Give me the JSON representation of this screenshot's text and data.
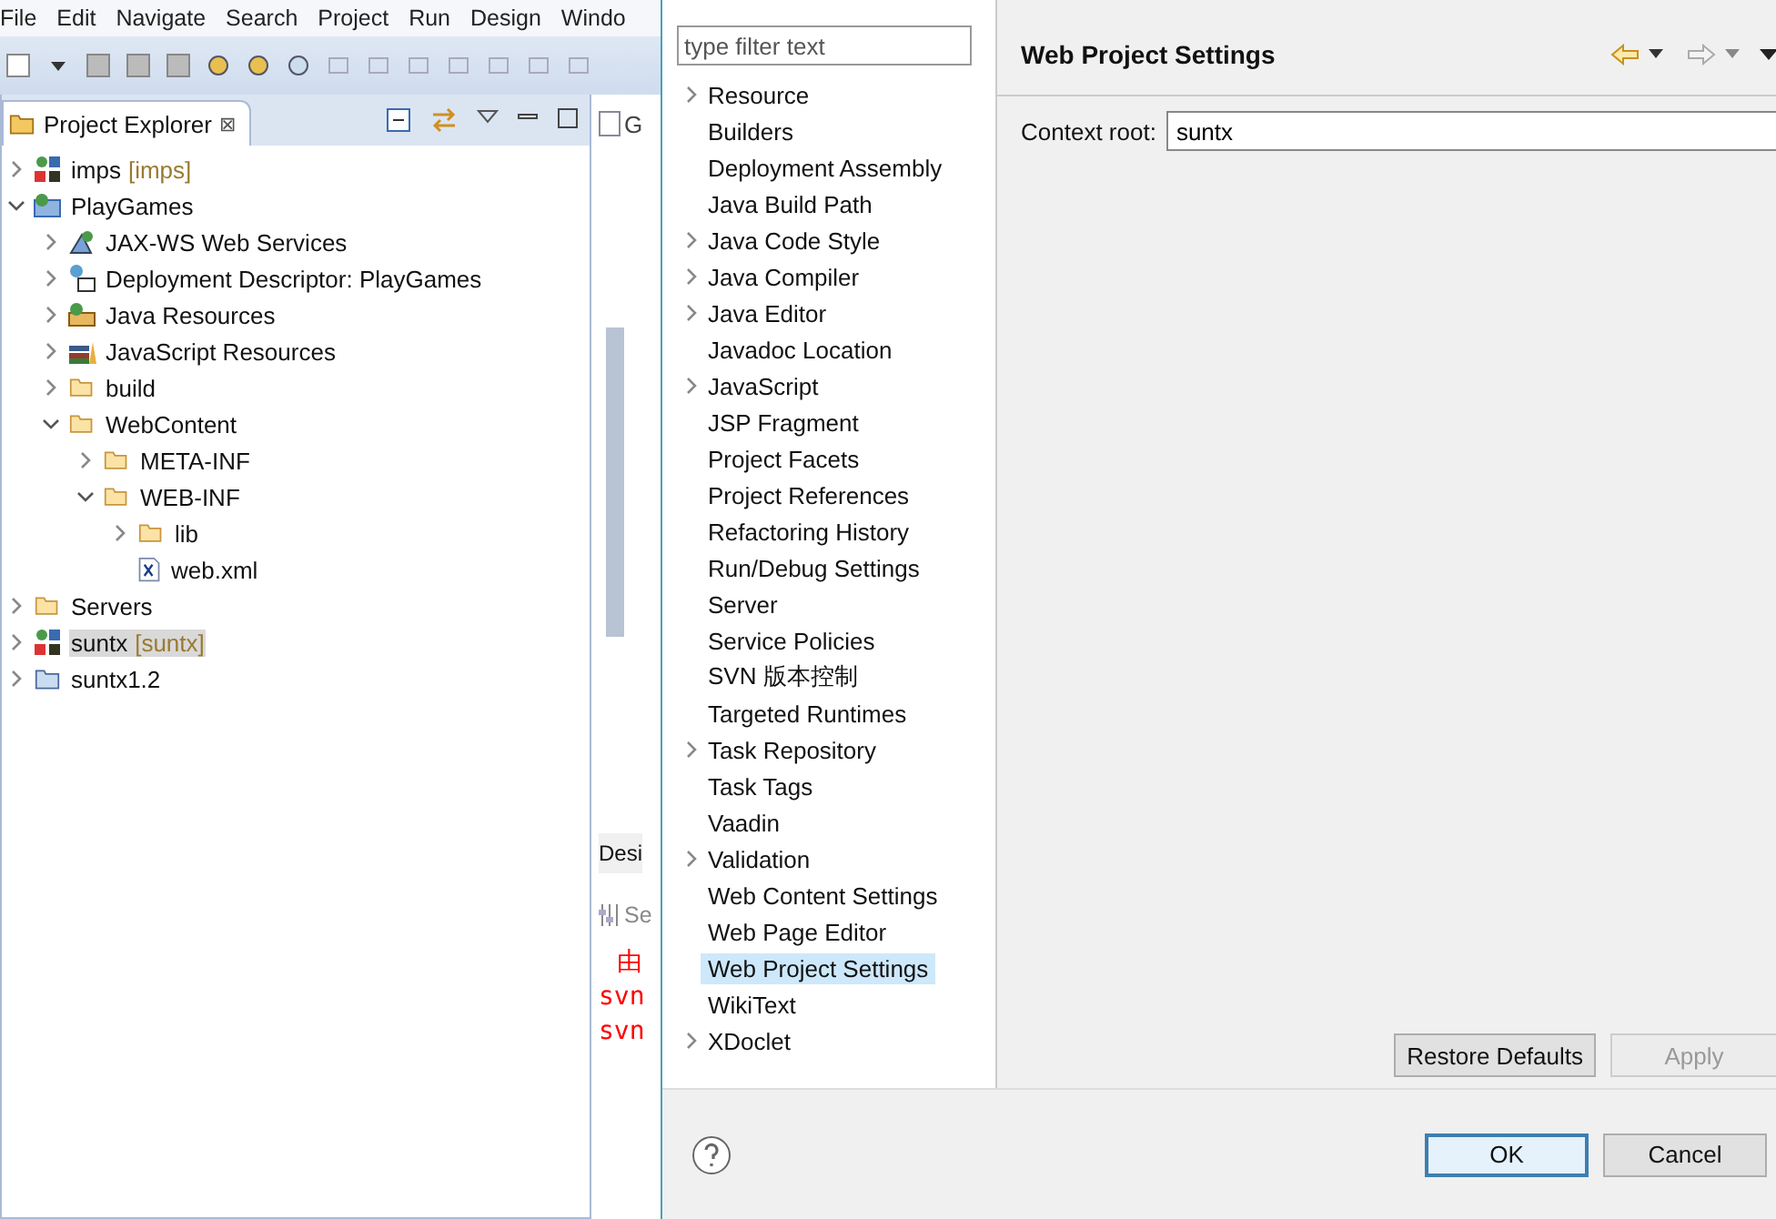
{
  "menu": [
    "File",
    "Edit",
    "Navigate",
    "Search",
    "Project",
    "Run",
    "Design",
    "Windo"
  ],
  "explorer": {
    "title": "Project Explorer",
    "close": "⊠",
    "tree": [
      {
        "label": "imps",
        "decoration": "[imps]",
        "kind": "project",
        "expanded": false,
        "selected": false
      },
      {
        "label": "PlayGames",
        "kind": "webproject",
        "expanded": true,
        "selected": false,
        "children": [
          {
            "label": "JAX-WS Web Services",
            "kind": "service",
            "expanded": false,
            "selected": false
          },
          {
            "label": "Deployment Descriptor: PlayGames",
            "kind": "descriptor",
            "expanded": false,
            "selected": false
          },
          {
            "label": "Java Resources",
            "kind": "javares",
            "expanded": false,
            "selected": false
          },
          {
            "label": "JavaScript Resources",
            "kind": "jsres",
            "expanded": false,
            "selected": false
          },
          {
            "label": "build",
            "kind": "folder",
            "expanded": false,
            "selected": false
          },
          {
            "label": "WebContent",
            "kind": "folder",
            "expanded": true,
            "selected": false,
            "children": [
              {
                "label": "META-INF",
                "kind": "folder",
                "expanded": false,
                "selected": false
              },
              {
                "label": "WEB-INF",
                "kind": "folder",
                "expanded": true,
                "selected": false,
                "children": [
                  {
                    "label": "lib",
                    "kind": "folder",
                    "expanded": false,
                    "selected": false
                  },
                  {
                    "label": "web.xml",
                    "kind": "file",
                    "selected": false
                  }
                ]
              }
            ]
          }
        ]
      },
      {
        "label": "Servers",
        "kind": "folder",
        "expanded": false,
        "selected": false
      },
      {
        "label": "suntx",
        "decoration": "[suntx]",
        "kind": "project",
        "expanded": false,
        "selected": true
      },
      {
        "label": "suntx1.2",
        "kind": "plain",
        "expanded": false,
        "selected": false
      }
    ]
  },
  "editor": {
    "tab": "G",
    "bottom_tab": "Desi",
    "console_tab": "Se",
    "console_lines": [
      {
        "text": "由",
        "color": "#ff0000"
      },
      {
        "text": "svn",
        "color": "#ff0000"
      },
      {
        "text": "svn",
        "color": "#ff0000"
      }
    ]
  },
  "dialog": {
    "filter": {
      "placeholder": "type filter text"
    },
    "nav": [
      {
        "label": "Resource",
        "has_children": true,
        "selected": false
      },
      {
        "label": "Builders",
        "has_children": false,
        "selected": false
      },
      {
        "label": "Deployment Assembly",
        "has_children": false,
        "selected": false
      },
      {
        "label": "Java Build Path",
        "has_children": false,
        "selected": false
      },
      {
        "label": "Java Code Style",
        "has_children": true,
        "selected": false
      },
      {
        "label": "Java Compiler",
        "has_children": true,
        "selected": false
      },
      {
        "label": "Java Editor",
        "has_children": true,
        "selected": false
      },
      {
        "label": "Javadoc Location",
        "has_children": false,
        "selected": false
      },
      {
        "label": "JavaScript",
        "has_children": true,
        "selected": false
      },
      {
        "label": "JSP Fragment",
        "has_children": false,
        "selected": false
      },
      {
        "label": "Project Facets",
        "has_children": false,
        "selected": false
      },
      {
        "label": "Project References",
        "has_children": false,
        "selected": false
      },
      {
        "label": "Refactoring History",
        "has_children": false,
        "selected": false
      },
      {
        "label": "Run/Debug Settings",
        "has_children": false,
        "selected": false
      },
      {
        "label": "Server",
        "has_children": false,
        "selected": false
      },
      {
        "label": "Service Policies",
        "has_children": false,
        "selected": false
      },
      {
        "label": "SVN 版本控制",
        "has_children": false,
        "selected": false
      },
      {
        "label": "Targeted Runtimes",
        "has_children": false,
        "selected": false
      },
      {
        "label": "Task Repository",
        "has_children": true,
        "selected": false
      },
      {
        "label": "Task Tags",
        "has_children": false,
        "selected": false
      },
      {
        "label": "Vaadin",
        "has_children": false,
        "selected": false
      },
      {
        "label": "Validation",
        "has_children": true,
        "selected": false
      },
      {
        "label": "Web Content Settings",
        "has_children": false,
        "selected": false
      },
      {
        "label": "Web Page Editor",
        "has_children": false,
        "selected": false
      },
      {
        "label": "Web Project Settings",
        "has_children": false,
        "selected": true
      },
      {
        "label": "WikiText",
        "has_children": false,
        "selected": false
      },
      {
        "label": "XDoclet",
        "has_children": true,
        "selected": false
      }
    ],
    "page_title": "Web Project Settings",
    "context_root": {
      "label": "Context root:",
      "value": "suntx"
    },
    "page_buttons": [
      {
        "label": "Restore Defaults",
        "disabled": false
      },
      {
        "label": "Apply",
        "disabled": true
      }
    ],
    "buttons": [
      {
        "label": "OK",
        "default": true
      },
      {
        "label": "Cancel",
        "default": false
      }
    ]
  }
}
